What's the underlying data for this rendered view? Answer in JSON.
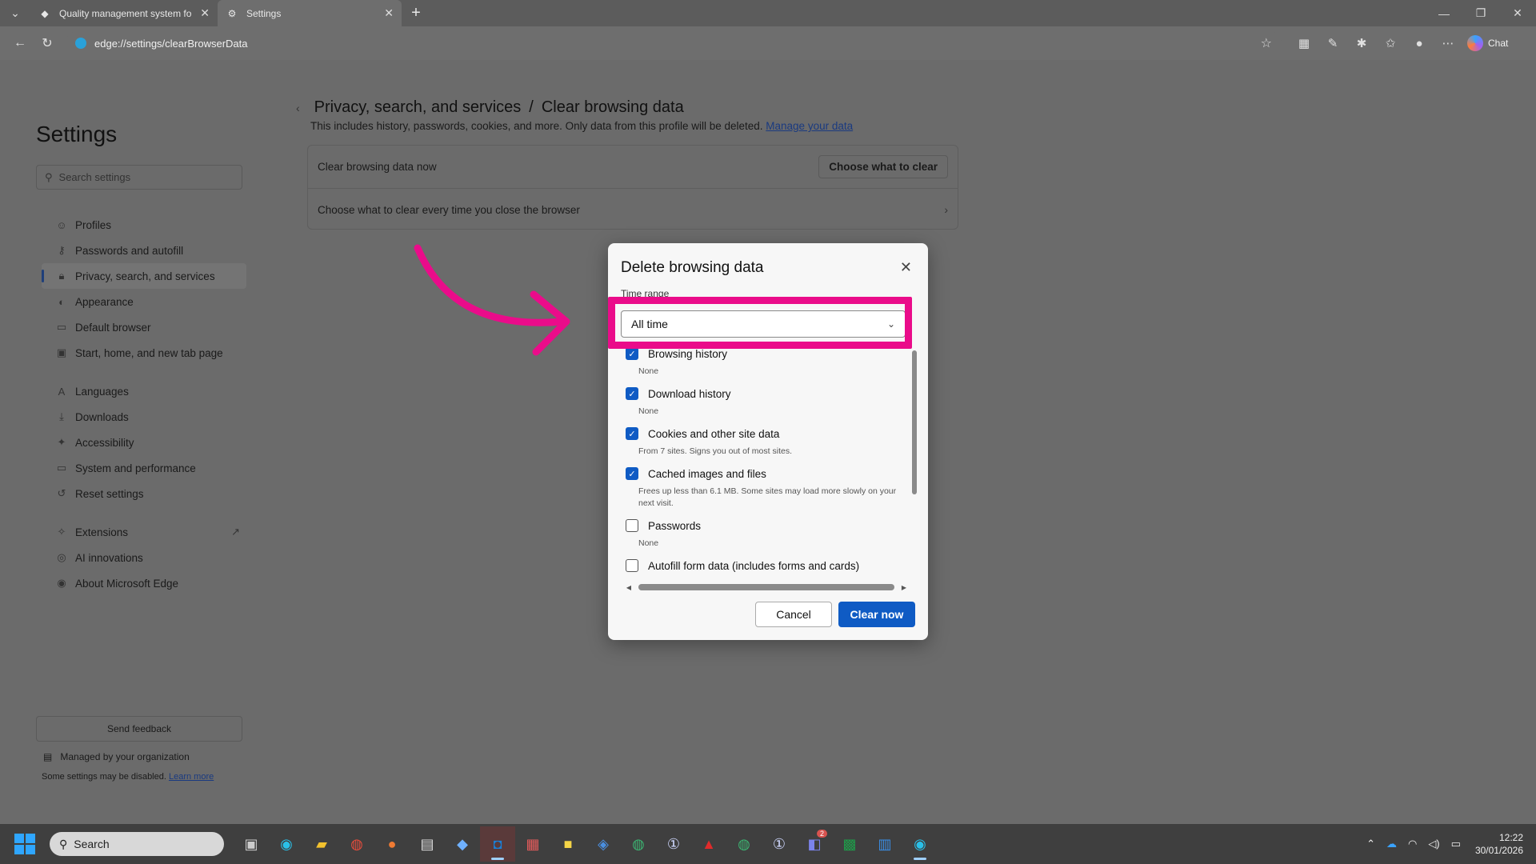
{
  "tabs": [
    {
      "label": "Quality management system for s",
      "icon": "page-icon"
    },
    {
      "label": "Settings",
      "icon": "gear-icon"
    }
  ],
  "address": {
    "url": "edge://settings/clearBrowserData",
    "chat_label": "Chat"
  },
  "sidebar": {
    "title": "Settings",
    "search_placeholder": "Search settings",
    "items": [
      {
        "label": "Profiles",
        "icon": "person-icon"
      },
      {
        "label": "Passwords and autofill",
        "icon": "key-icon"
      },
      {
        "label": "Privacy, search, and services",
        "icon": "lock-icon",
        "active": true
      },
      {
        "label": "Appearance",
        "icon": "palette-icon"
      },
      {
        "label": "Default browser",
        "icon": "browser-icon"
      },
      {
        "label": "Start, home, and new tab page",
        "icon": "home-icon"
      },
      {
        "label": "Languages",
        "icon": "language-icon"
      },
      {
        "label": "Downloads",
        "icon": "download-icon"
      },
      {
        "label": "Accessibility",
        "icon": "accessibility-icon"
      },
      {
        "label": "System and performance",
        "icon": "monitor-icon"
      },
      {
        "label": "Reset settings",
        "icon": "reset-icon"
      },
      {
        "label": "Extensions",
        "icon": "puzzle-icon"
      },
      {
        "label": "AI innovations",
        "icon": "ai-icon"
      },
      {
        "label": "About Microsoft Edge",
        "icon": "edge-icon"
      }
    ],
    "feedback_label": "Send feedback",
    "managed_label": "Managed by your organization",
    "disabled_note": "Some settings may be disabled.",
    "learn_more": "Learn more"
  },
  "main": {
    "breadcrumb_parent": "Privacy, search, and services",
    "breadcrumb_sep": "/",
    "breadcrumb_current": "Clear browsing data",
    "subtitle": "This includes history, passwords, cookies, and more. Only data from this profile will be deleted.",
    "manage_link": "Manage your data",
    "row1_label": "Clear browsing data now",
    "row1_button": "Choose what to clear",
    "row2_label": "Choose what to clear every time you close the browser"
  },
  "dialog": {
    "title": "Delete browsing data",
    "time_range_label": "Time range",
    "time_range_value": "All time",
    "options": [
      {
        "label": "Browsing history",
        "desc": "None",
        "checked": true
      },
      {
        "label": "Download history",
        "desc": "None",
        "checked": true
      },
      {
        "label": "Cookies and other site data",
        "desc": "From 7 sites. Signs you out of most sites.",
        "checked": true
      },
      {
        "label": "Cached images and files",
        "desc": "Frees up less than 6.1 MB. Some sites may load more slowly on your next visit.",
        "checked": true
      },
      {
        "label": "Passwords",
        "desc": "None",
        "checked": false
      },
      {
        "label": "Autofill form data (includes forms and cards)",
        "desc": "",
        "checked": false
      }
    ],
    "cancel_label": "Cancel",
    "clear_label": "Clear now"
  },
  "taskbar": {
    "search_label": "Search",
    "time": "12:22",
    "date": "30/01/2026",
    "teams_badge": "2"
  },
  "colors": {
    "highlight": "#ea0c8a",
    "accent": "#0f5bc4"
  }
}
